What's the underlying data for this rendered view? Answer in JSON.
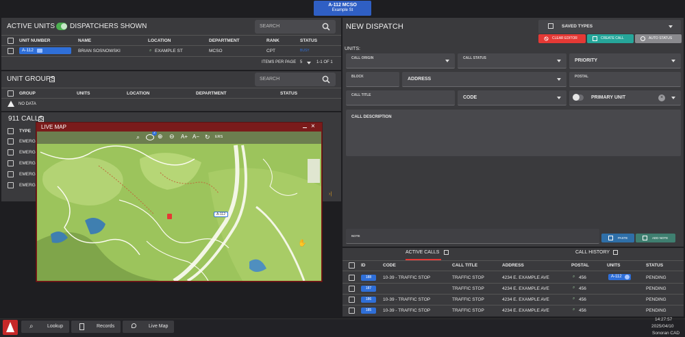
{
  "unit_badge": {
    "title": "A-112 MCSO",
    "subtitle": "Example St"
  },
  "active_units": {
    "title": "ACTIVE UNITS",
    "dispatchers_label": "DISPATCHERS SHOWN",
    "search_placeholder": "SEARCH",
    "columns": [
      "UNIT NUMBER",
      "NAME",
      "LOCATION",
      "DEPARTMENT",
      "RANK",
      "STATUS"
    ],
    "rows": [
      {
        "unit": "A-112",
        "name": "BRIAN SOSNOWSKI",
        "location": "EXAMPLE ST",
        "department": "MCSO",
        "rank": "CPT",
        "status": "BUSY"
      }
    ],
    "items_per_page_label": "ITEMS PER PAGE",
    "items_per_page": "5",
    "range": "1-1 OF 1"
  },
  "unit_groups": {
    "title": "UNIT GROUPS",
    "search_placeholder": "SEARCH",
    "columns": [
      "GROUP",
      "UNITS",
      "LOCATION",
      "DEPARTMENT",
      "STATUS"
    ],
    "no_data": "NO DATA"
  },
  "calls911": {
    "title": "911 CALLS",
    "columns": [
      "TYPE"
    ],
    "rows": [
      "EMERG",
      "EMERG",
      "EMERG",
      "EMERG",
      "EMERG"
    ]
  },
  "live_map": {
    "title": "LIVE MAP",
    "toolbar_ers": "ERS",
    "badge_count": "2",
    "marker_label": "A-112"
  },
  "new_dispatch": {
    "title": "NEW DISPATCH",
    "saved_types": "SAVED TYPES",
    "clear_editor": "CLEAR EDITOR",
    "create_call": "CREATE CALL",
    "auto_status": "AUTO STATUS",
    "units_label": "UNITS:",
    "fields": {
      "call_origin": "CALL ORIGIN",
      "call_status": "CALL STATUS",
      "priority": "PRIORITY",
      "block": "BLOCK",
      "address": "ADDRESS",
      "postal": "POSTAL",
      "call_title": "CALL TITLE",
      "code": "CODE",
      "primary_unit": "PRIMARY UNIT",
      "call_description": "CALL DESCRIPTION",
      "note": "NOTE"
    },
    "paste": "PASTE",
    "add_note": "ADD NOTE"
  },
  "calls": {
    "tab_active": "ACTIVE CALLS",
    "tab_history": "CALL HISTORY",
    "columns": [
      "ID",
      "CODE",
      "CALL TITLE",
      "ADDRESS",
      "POSTAL",
      "UNITS",
      "STATUS"
    ],
    "rows": [
      {
        "id": "188",
        "code": "10-39 - TRAFFIC STOP",
        "title": "TRAFFIC STOP",
        "address": "4234 E. EXAMPLE AVE",
        "postal": "456",
        "units": "A-112",
        "status": "PENDING"
      },
      {
        "id": "187",
        "code": "",
        "title": "TRAFFIC STOP",
        "address": "4234 E. EXAMPLE AVE",
        "postal": "456",
        "units": "",
        "status": "PENDING"
      },
      {
        "id": "186",
        "code": "10-39 - TRAFFIC STOP",
        "title": "TRAFFIC STOP",
        "address": "4234 E. EXAMPLE AVE",
        "postal": "456",
        "units": "",
        "status": "PENDING"
      },
      {
        "id": "185",
        "code": "10-39 - TRAFFIC STOP",
        "title": "TRAFFIC STOP",
        "address": "4234 E. EXAMPLE AVE",
        "postal": "456",
        "units": "",
        "status": "PENDING"
      }
    ]
  },
  "taskbar": {
    "lookup": "Lookup",
    "records": "Records",
    "live_map": "Live Map",
    "time": "14:27:57",
    "date": "2025/04/10",
    "app_name": "Sonoran CAD"
  },
  "colors": {
    "accent_blue": "#2f6fd8",
    "danger": "#e53935",
    "success": "#26a69a",
    "map_frame": "#7a1b1b",
    "map_green": "#9bc15a"
  }
}
